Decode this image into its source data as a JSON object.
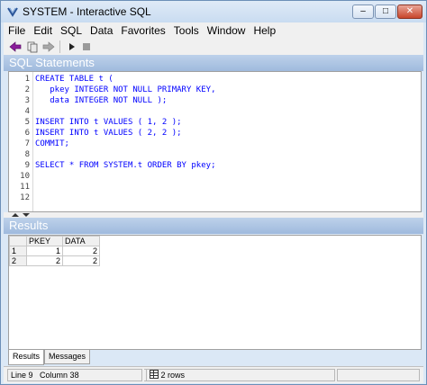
{
  "window": {
    "title": "SYSTEM - Interactive SQL",
    "controls": {
      "minimize": "–",
      "maximize": "□",
      "close": "✕"
    }
  },
  "menu": [
    {
      "id": "file",
      "label": "File"
    },
    {
      "id": "edit",
      "label": "Edit"
    },
    {
      "id": "sql",
      "label": "SQL"
    },
    {
      "id": "data",
      "label": "Data"
    },
    {
      "id": "favorites",
      "label": "Favorites"
    },
    {
      "id": "tools",
      "label": "Tools"
    },
    {
      "id": "window",
      "label": "Window"
    },
    {
      "id": "help",
      "label": "Help"
    }
  ],
  "toolbar": {
    "icons": [
      "back-arrow-icon",
      "bookmark-icon",
      "forward-arrow-icon",
      "execute-icon",
      "stop-icon"
    ]
  },
  "sql_panel": {
    "header": "SQL Statements",
    "line_numbers": [
      "1",
      "2",
      "3",
      "4",
      "5",
      "6",
      "7",
      "8",
      "9",
      "10",
      "11",
      "12"
    ],
    "lines": [
      "CREATE TABLE t (",
      "   pkey INTEGER NOT NULL PRIMARY KEY,",
      "   data INTEGER NOT NULL );",
      "",
      "INSERT INTO t VALUES ( 1, 2 );",
      "INSERT INTO t VALUES ( 2, 2 );",
      "COMMIT;",
      "",
      "SELECT * FROM SYSTEM.t ORDER BY pkey;",
      "",
      "",
      ""
    ]
  },
  "results_panel": {
    "header": "Results",
    "columns": [
      "PKEY",
      "DATA"
    ],
    "rows": [
      {
        "num": "1",
        "pkey": "1",
        "data": "2"
      },
      {
        "num": "2",
        "pkey": "2",
        "data": "2"
      }
    ],
    "tabs": [
      {
        "label": "Results",
        "active": true
      },
      {
        "label": "Messages",
        "active": false
      }
    ]
  },
  "status": {
    "line": "Line 9",
    "column": "Column 38",
    "rows": "2 rows"
  },
  "colors": {
    "header_gradient_top": "#bdd1ea",
    "header_gradient_bottom": "#9fbadd",
    "keyword": "#0000ff",
    "window_frame": "#dbe8f6"
  }
}
